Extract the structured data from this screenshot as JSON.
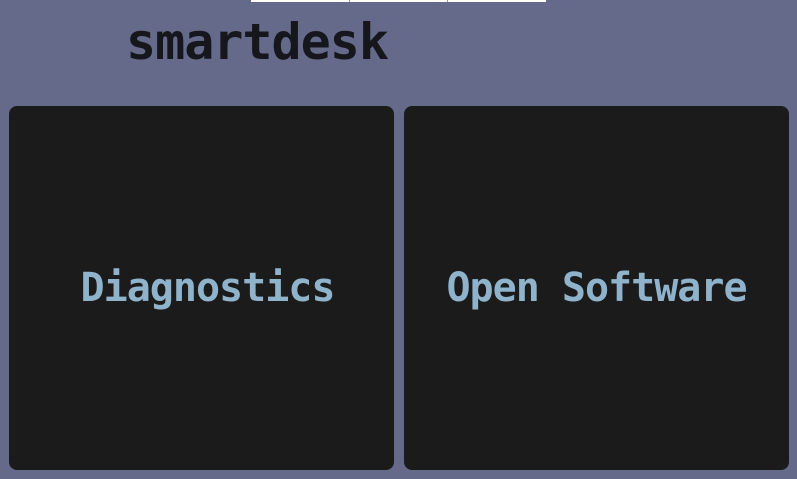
{
  "app": {
    "title": "smartdesk"
  },
  "tiles": [
    {
      "label": "Diagnostics"
    },
    {
      "label": "Open Software"
    }
  ],
  "colors": {
    "background": "#666a8a",
    "tile": "#1b1b1c",
    "tile_text": "#8fb3cb",
    "title_text": "#16171c"
  }
}
